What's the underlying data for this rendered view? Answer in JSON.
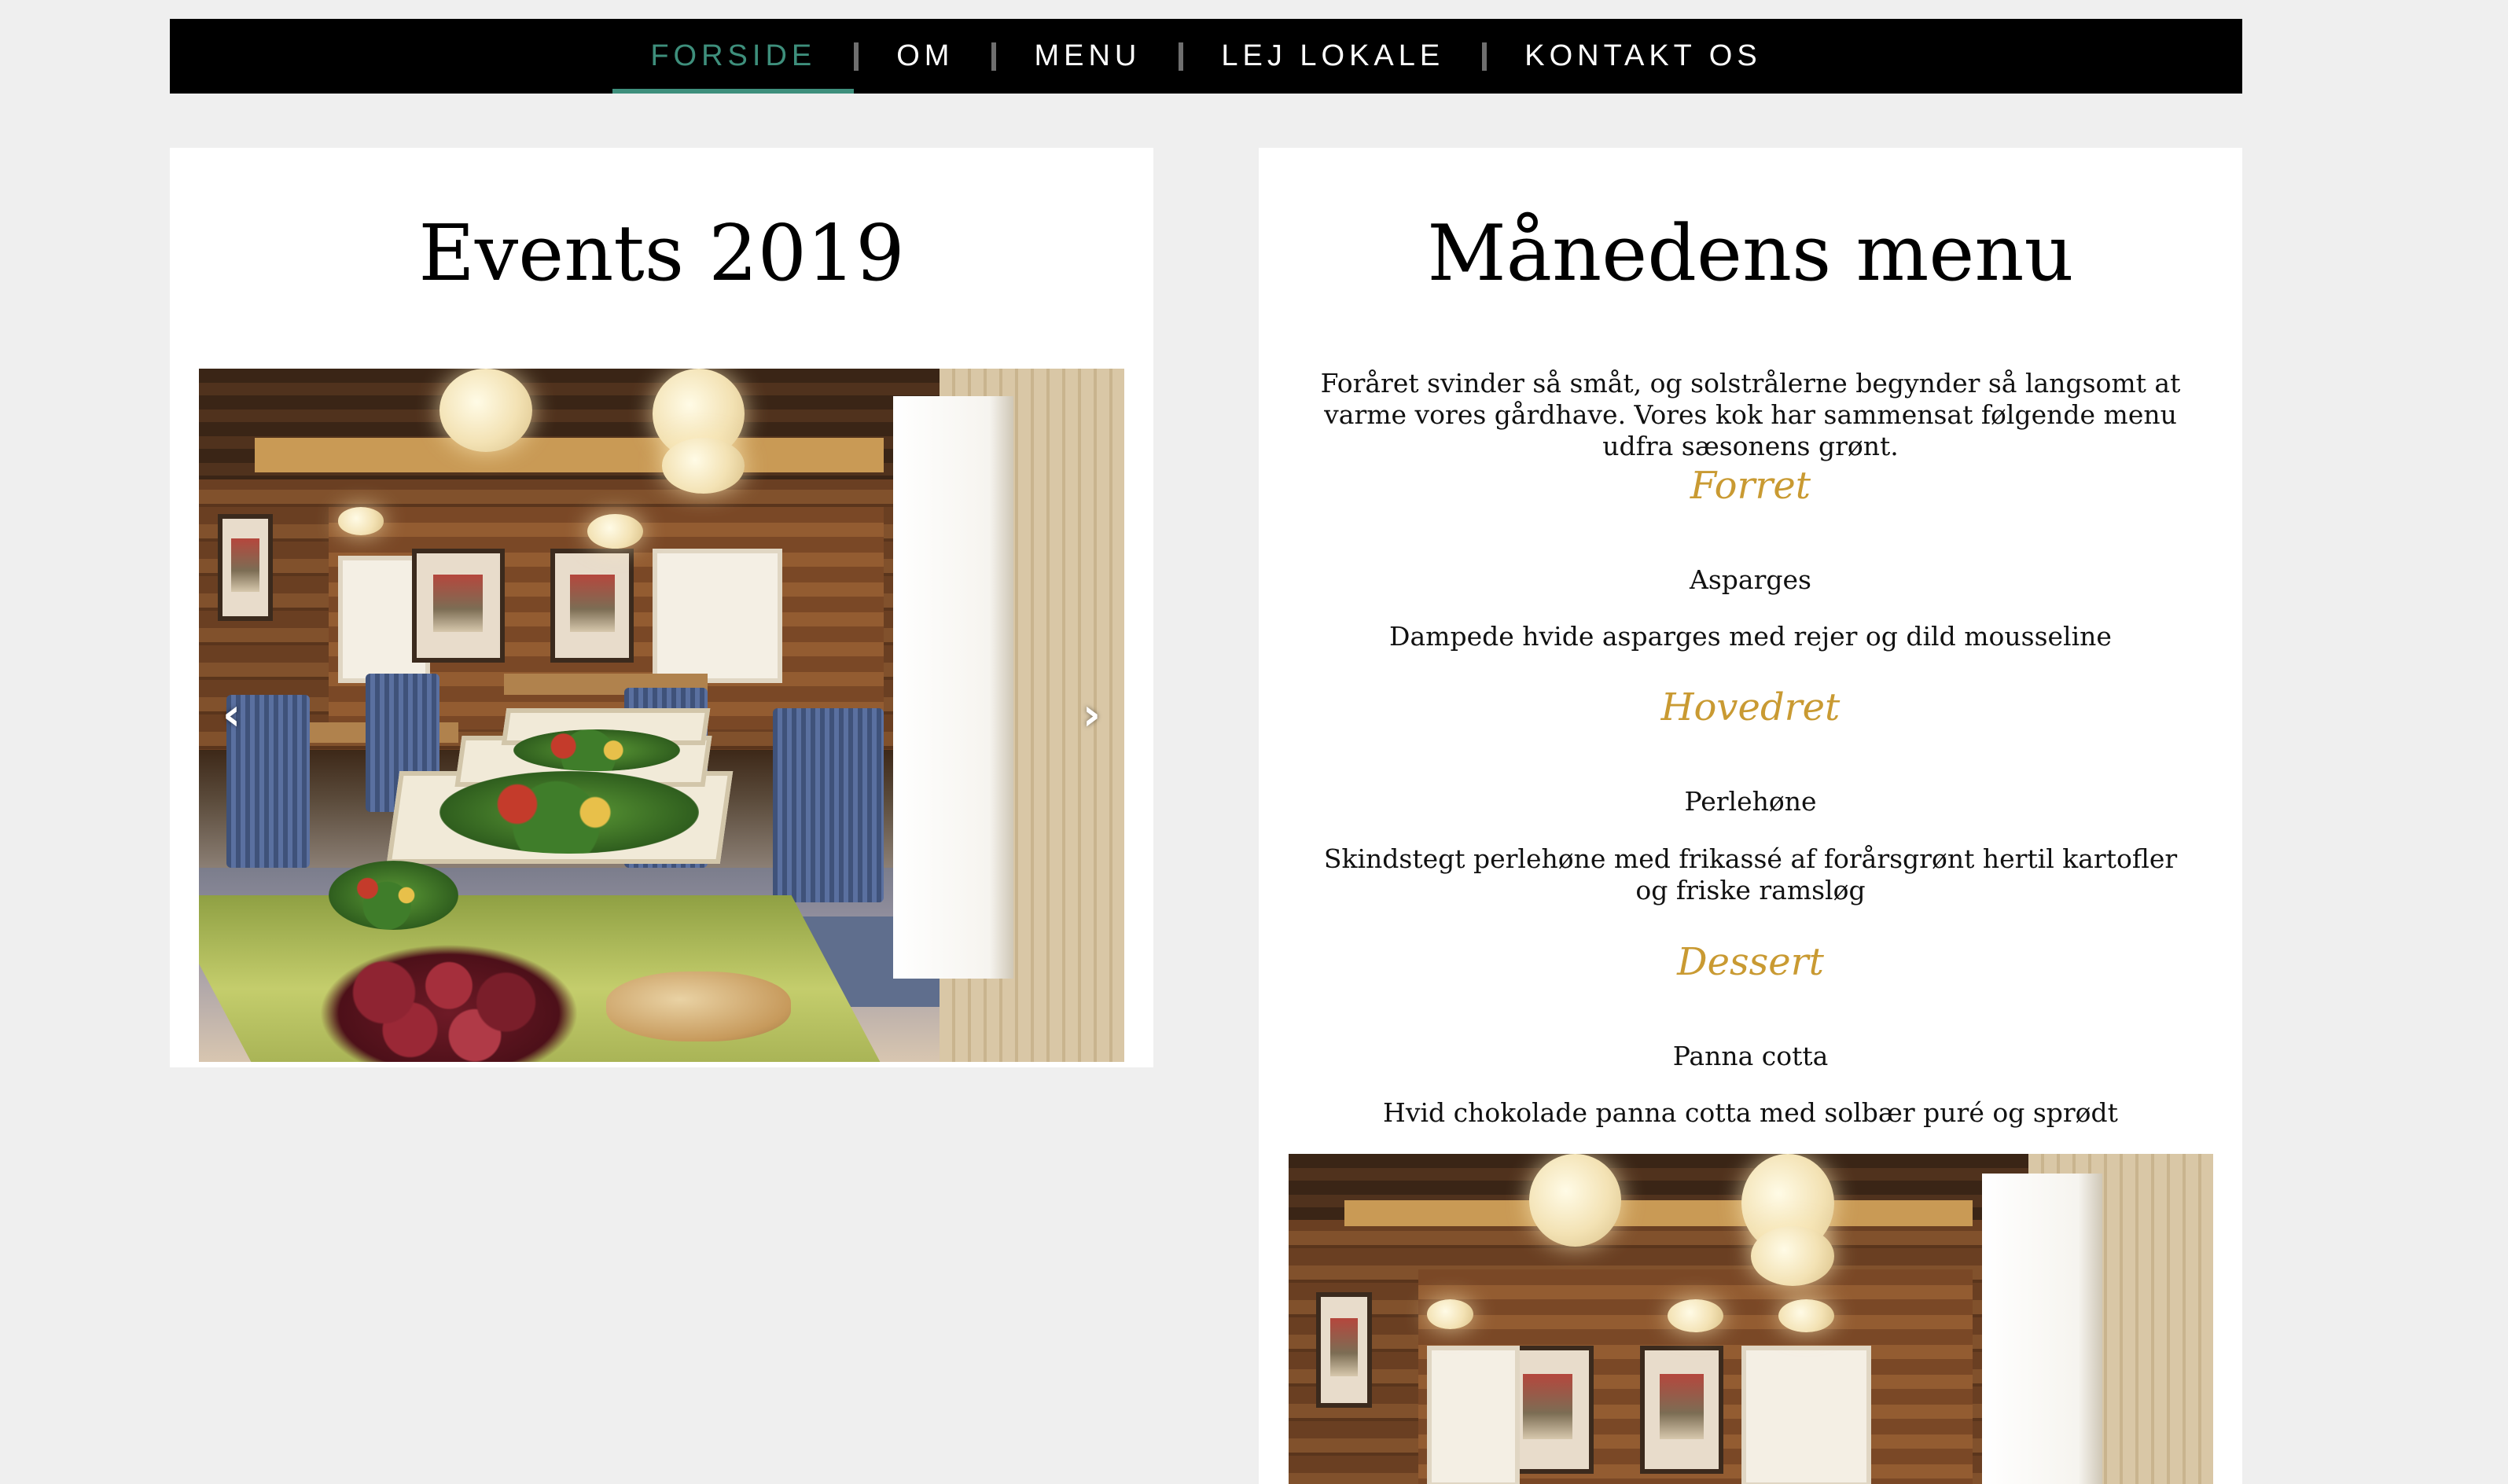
{
  "nav": {
    "items": [
      {
        "label": "FORSIDE",
        "active": true
      },
      {
        "label": "OM",
        "active": false
      },
      {
        "label": "MENU",
        "active": false
      },
      {
        "label": "LEJ LOKALE",
        "active": false
      },
      {
        "label": "KONTAKT OS",
        "active": false
      }
    ],
    "active_color": "#3e8f7c",
    "bar_color": "#000000"
  },
  "events": {
    "title": "Events 2019",
    "carousel": {
      "prev_icon": "‹",
      "next_icon": "›"
    }
  },
  "menu": {
    "title": "Månedens menu",
    "intro": "Foråret svinder så småt, og solstrålerne begynder så langsomt at varme vores gårdhave. Vores kok har sammensat følgende menu udfra sæsonens grønt.",
    "section_color": "#c99a32",
    "sections": [
      {
        "title": "Forret",
        "dish_name": "Asparges",
        "dish_desc": "Dampede hvide asparges med rejer og dild mousseline"
      },
      {
        "title": "Hovedret",
        "dish_name": "Perlehøne",
        "dish_desc": "Skindstegt perlehøne med frikassé af forårsgrønt hertil kartofler og friske ramsløg"
      },
      {
        "title": "Dessert",
        "dish_name": "Panna cotta",
        "dish_desc": "Hvid chokolade panna cotta med solbær puré og sprødt"
      }
    ]
  }
}
